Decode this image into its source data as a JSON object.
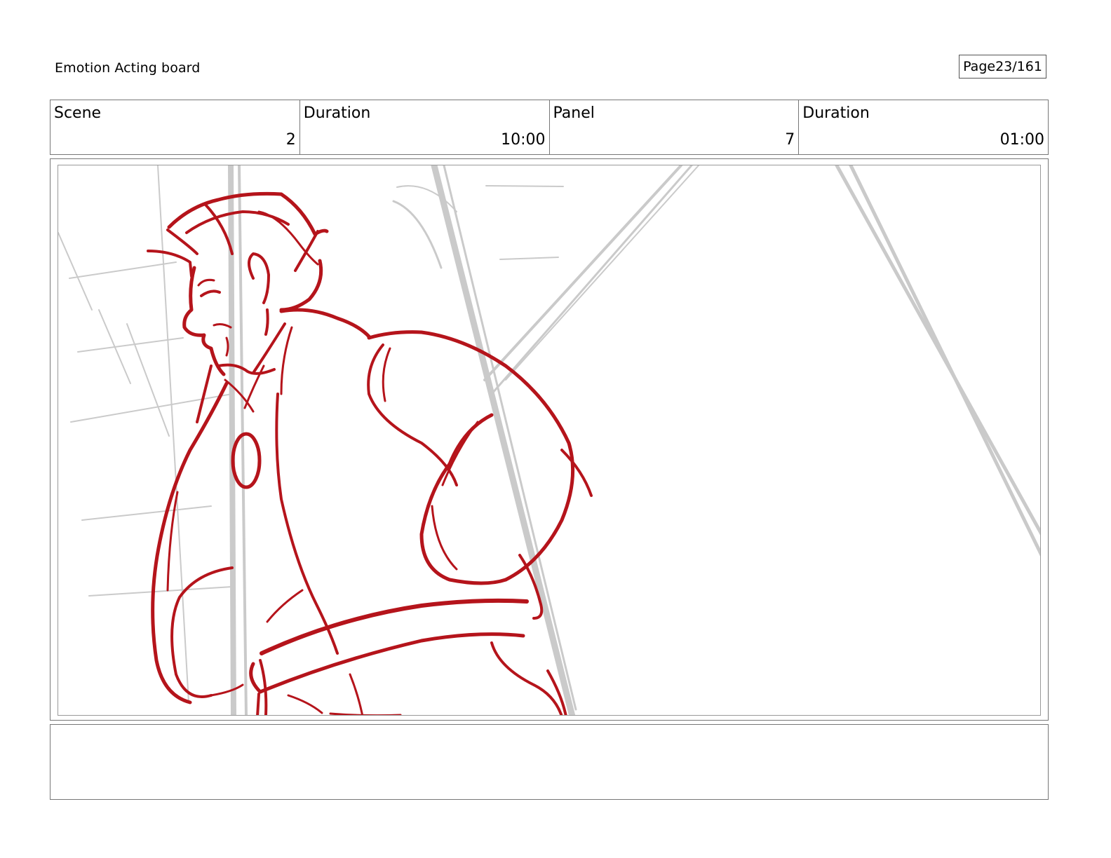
{
  "header": {
    "title": "Emotion Acting board",
    "page_label": "Page",
    "page_number": "23/161"
  },
  "info": {
    "scene_label": "Scene",
    "scene_value": "2",
    "scene_duration_label": "Duration",
    "scene_duration_value": "10:00",
    "panel_label": "Panel",
    "panel_value": "7",
    "panel_duration_label": "Duration",
    "panel_duration_value": "01:00"
  },
  "sketch": {
    "line_color": "#b5141b",
    "guide_color": "#c8c8c8"
  },
  "notes": {
    "text": ""
  }
}
